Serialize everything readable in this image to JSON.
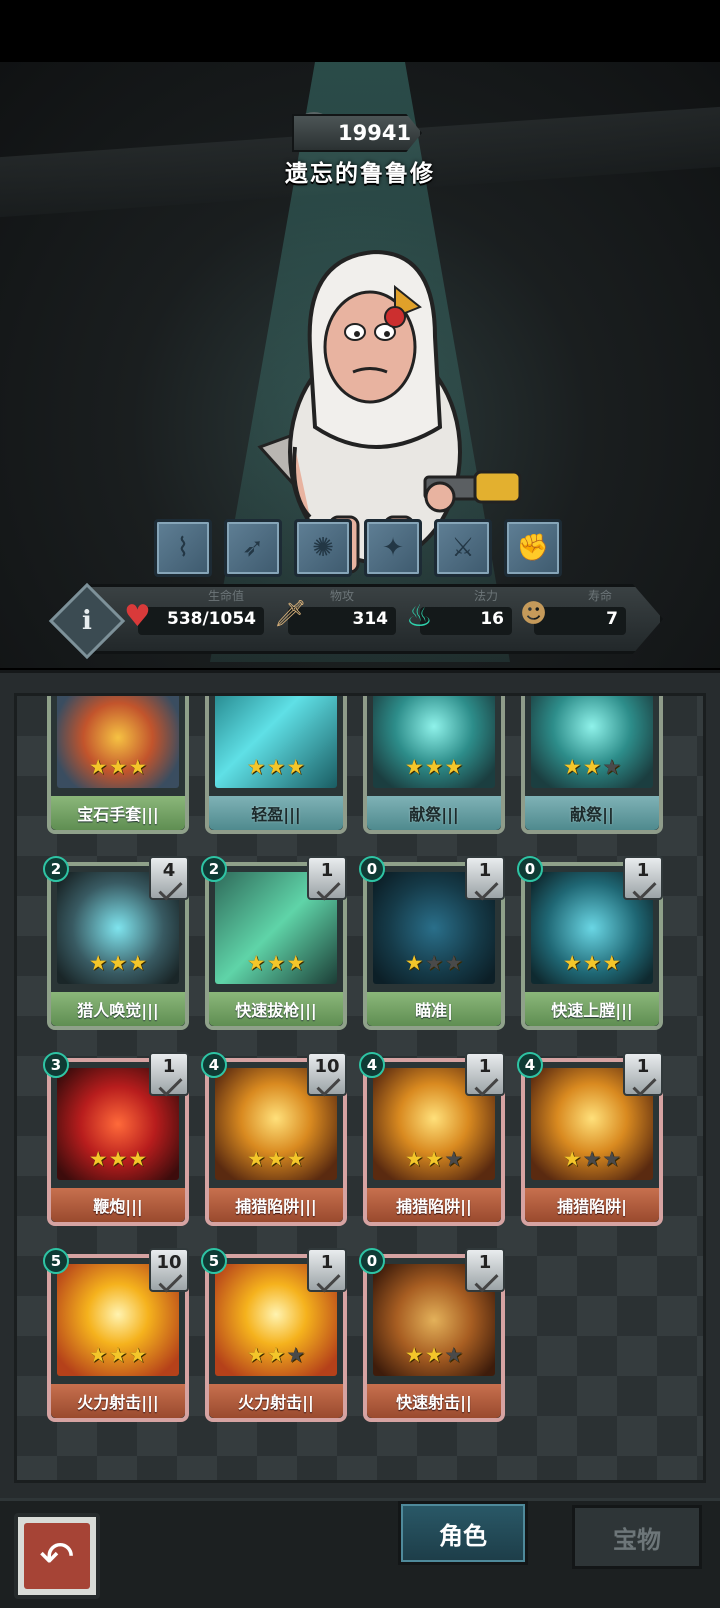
{
  "character": {
    "score": "19941",
    "name": "遗忘的鲁鲁修"
  },
  "skills": [
    "broom-icon",
    "bow-icon",
    "rock-icon",
    "bomb-icon",
    "swords-icon",
    "glove-icon"
  ],
  "stats": {
    "health": {
      "label": "生命值",
      "value": "538/1054"
    },
    "attack": {
      "label": "物攻",
      "value": "314"
    },
    "mana": {
      "label": "法力",
      "value": "16"
    },
    "lives": {
      "label": "寿命",
      "value": "7"
    }
  },
  "cards": [
    {
      "name": "宝石手套|||",
      "cost": "",
      "count": "",
      "stars": 3,
      "frame": "green",
      "art": "gem-glove"
    },
    {
      "name": "轻盈|||",
      "cost": "",
      "count": "",
      "stars": 3,
      "frame": "teal",
      "art": "feather"
    },
    {
      "name": "献祭|||",
      "cost": "",
      "count": "",
      "stars": 3,
      "frame": "teal",
      "art": "ghost"
    },
    {
      "name": "献祭||",
      "cost": "",
      "count": "",
      "stars": 2,
      "frame": "teal",
      "art": "ghost"
    },
    {
      "name": "猎人唤觉|||",
      "cost": "2",
      "count": "4",
      "stars": 3,
      "frame": "green",
      "art": "hunter"
    },
    {
      "name": "快速拔枪|||",
      "cost": "2",
      "count": "1",
      "stars": 3,
      "frame": "green",
      "art": "quickdraw"
    },
    {
      "name": "瞄准|",
      "cost": "0",
      "count": "1",
      "stars": 1,
      "frame": "green",
      "art": "aim"
    },
    {
      "name": "快速上膛|||",
      "cost": "0",
      "count": "1",
      "stars": 3,
      "frame": "green",
      "art": "reload"
    },
    {
      "name": "鞭炮|||",
      "cost": "3",
      "count": "1",
      "stars": 3,
      "frame": "red",
      "art": "firecracker"
    },
    {
      "name": "捕猎陷阱|||",
      "cost": "4",
      "count": "10",
      "stars": 3,
      "frame": "red",
      "art": "trap"
    },
    {
      "name": "捕猎陷阱||",
      "cost": "4",
      "count": "1",
      "stars": 2,
      "frame": "red",
      "art": "trap"
    },
    {
      "name": "捕猎陷阱|",
      "cost": "4",
      "count": "1",
      "stars": 1,
      "frame": "red",
      "art": "trap"
    },
    {
      "name": "火力射击|||",
      "cost": "5",
      "count": "10",
      "stars": 3,
      "frame": "red",
      "art": "fireshot"
    },
    {
      "name": "火力射击||",
      "cost": "5",
      "count": "1",
      "stars": 2,
      "frame": "red",
      "art": "fireshot"
    },
    {
      "name": "快速射击||",
      "cost": "0",
      "count": "1",
      "stars": 2,
      "frame": "red",
      "art": "quickshot"
    }
  ],
  "nav": {
    "back_icon": "back-arrow-icon",
    "tab_character": "角色",
    "tab_treasure": "宝物"
  }
}
